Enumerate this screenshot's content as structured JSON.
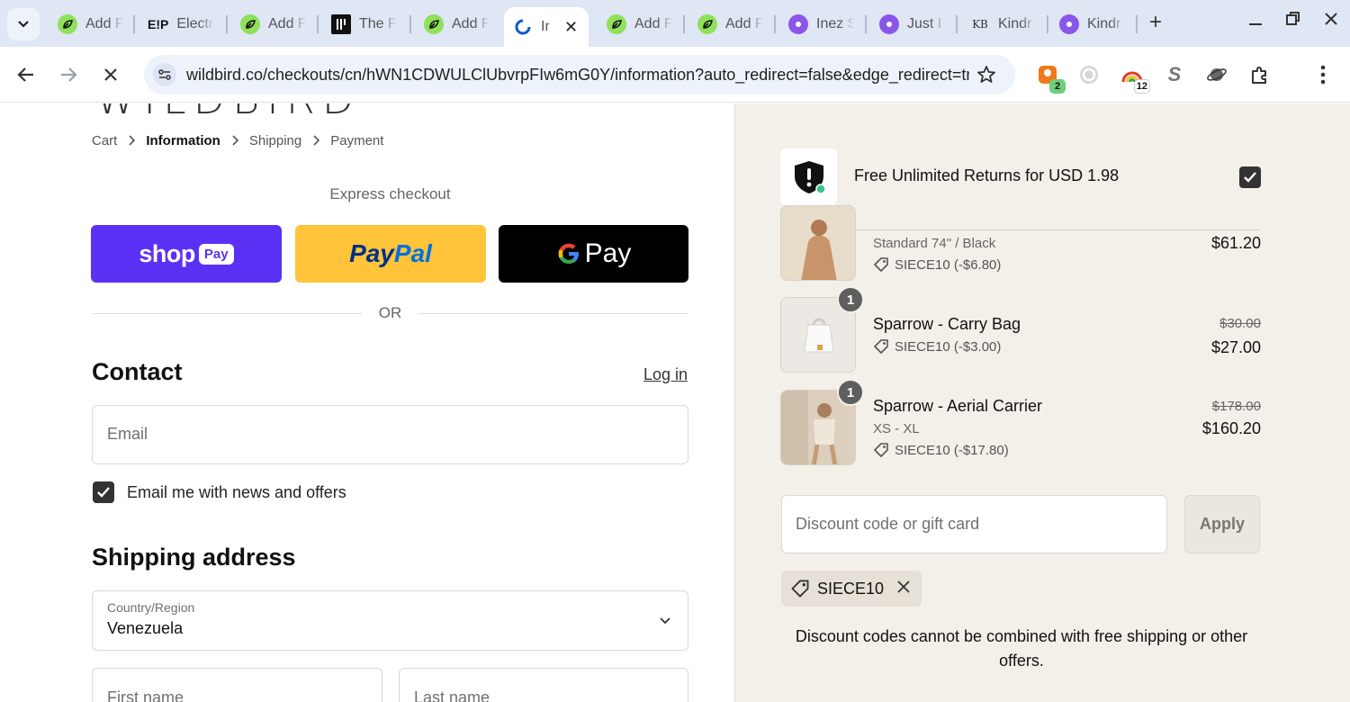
{
  "browser": {
    "tabs": [
      {
        "label": "Add F",
        "icon": "green-leaf"
      },
      {
        "label": "Electr",
        "icon": "ep-logo",
        "fav_text": "E!P"
      },
      {
        "label": "Add F",
        "icon": "green-leaf"
      },
      {
        "label": "The F",
        "icon": "bars-logo"
      },
      {
        "label": "Add F",
        "icon": "green-leaf"
      },
      {
        "label": "Ir",
        "icon": "loading",
        "active": true
      },
      {
        "label": "Add F",
        "icon": "green-leaf"
      },
      {
        "label": "Add F",
        "icon": "green-leaf"
      },
      {
        "label": "Inez S",
        "icon": "purple-gear"
      },
      {
        "label": "Just I",
        "icon": "purple-gear"
      },
      {
        "label": "Kindr",
        "icon": "kb-logo",
        "fav_text": "KB"
      },
      {
        "label": "Kindr",
        "icon": "purple-gear"
      }
    ],
    "url": "wildbird.co/checkouts/cn/hWN1CDWULClUbvrpFIw6mG0Y/information?auto_redirect=false&edge_redirect=true",
    "extensions": {
      "badge_one": "2",
      "badge_two": "12",
      "s_letter": "S"
    }
  },
  "checkout": {
    "brand": "WILDBIRD",
    "breadcrumbs": {
      "cart": "Cart",
      "information": "Information",
      "shipping": "Shipping",
      "payment": "Payment"
    },
    "express_label": "Express checkout",
    "shop_pay": {
      "word": "shop",
      "pill": "Pay"
    },
    "paypal": {
      "part1": "Pay",
      "part2": "Pal"
    },
    "gpay": {
      "word": "Pay"
    },
    "or_label": "OR",
    "contact": {
      "heading": "Contact",
      "login": "Log in",
      "email_placeholder": "Email",
      "news_label": "Email me with news and offers"
    },
    "shipping": {
      "heading": "Shipping address",
      "country_label": "Country/Region",
      "country_value": "Venezuela",
      "first_name_placeholder": "First name",
      "last_name_placeholder": "Last name"
    }
  },
  "summary": {
    "returns_text": "Free Unlimited Returns for USD 1.98",
    "items": [
      {
        "name": "",
        "variant": "Standard 74\" / Black",
        "discount": "SIECE10 (-$6.80)",
        "old_price": "",
        "price": "$61.20",
        "qty": ""
      },
      {
        "name": "Sparrow - Carry Bag",
        "variant": "",
        "discount": "SIECE10 (-$3.00)",
        "old_price": "$30.00",
        "price": "$27.00",
        "qty": "1"
      },
      {
        "name": "Sparrow - Aerial Carrier",
        "variant": "XS - XL",
        "discount": "SIECE10 (-$17.80)",
        "old_price": "$178.00",
        "price": "$160.20",
        "qty": "1"
      }
    ],
    "discount_placeholder": "Discount code or gift card",
    "apply_label": "Apply",
    "applied_code": "SIECE10",
    "note": "Discount codes cannot be combined with free shipping or other offers."
  },
  "colors": {
    "shop_pay": "#5a31f4",
    "paypal": "#ffc439",
    "gpay": "#000000",
    "summary_bg": "#f3efe9"
  }
}
